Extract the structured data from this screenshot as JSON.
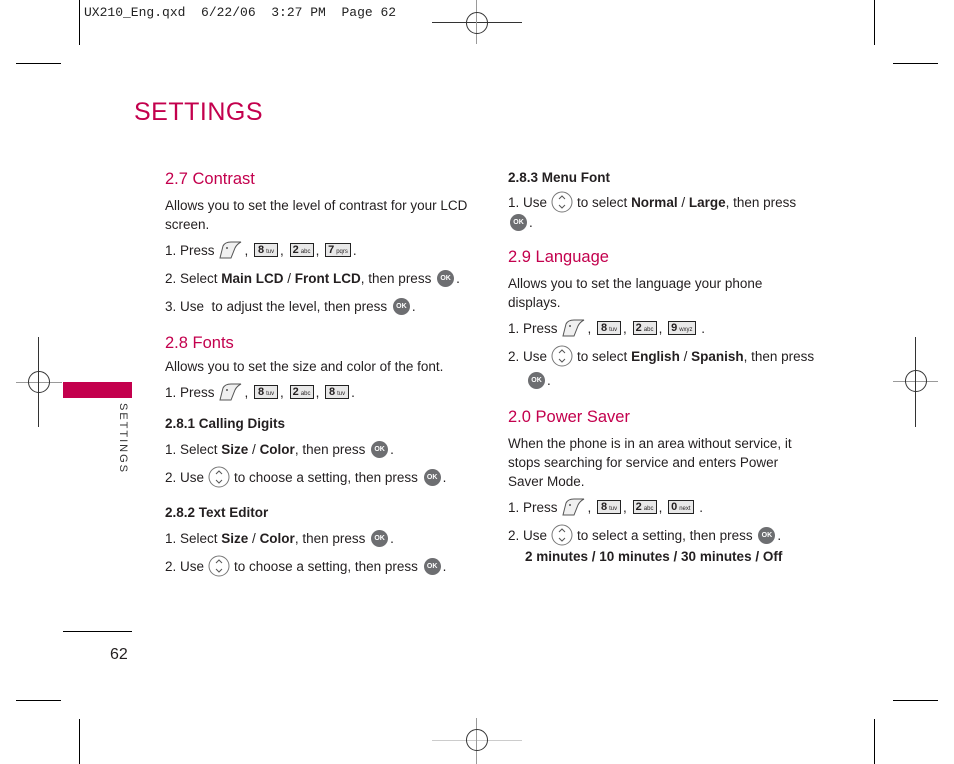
{
  "slug": {
    "filename": "UX210_Eng.qxd",
    "date": "6/22/06",
    "time": "3:27 PM",
    "page_label": "Page 62"
  },
  "page_title": "SETTINGS",
  "side_tab": {
    "label": "SETTINGS",
    "color": "#c3004d"
  },
  "page_number": "62",
  "accent_color": "#c3004d",
  "icons": {
    "menu_key": "menu-soft-key-icon",
    "nav_key": "navigation-up-down-key-icon",
    "ok_key": "ok-key-icon"
  },
  "ok_label": "OK",
  "keys": {
    "k8": {
      "main": "8",
      "sub": "tuv"
    },
    "k2": {
      "main": "2",
      "sub": "abc"
    },
    "k7": {
      "main": "7",
      "sub": "pqrs"
    },
    "k9": {
      "main": "9",
      "sub": "wxyz"
    },
    "k0": {
      "main": "0",
      "sub": "next"
    }
  },
  "sections": {
    "contrast": {
      "heading": "2.7 Contrast",
      "description": "Allows you to set the level of contrast for your LCD screen.",
      "step1_prefix": "1. Press",
      "step2_prefix": "2. Select ",
      "step2_opt1": "Main LCD",
      "step2_sep": " / ",
      "step2_opt2": "Front LCD",
      "step2_suffix": ", then press ",
      "step3_text": "3. Use  to adjust the level, then press "
    },
    "fonts": {
      "heading": "2.8 Fonts",
      "description": "Allows you to set the size and color of the font.",
      "step1_prefix": "1. Press",
      "calling_digits": {
        "heading": "2.8.1 Calling Digits",
        "step1_prefix": "1. Select ",
        "opt1": "Size",
        "sep": " / ",
        "opt2": "Color",
        "step1_suffix": ", then press ",
        "step2_prefix": "2. Use",
        "step2_suffix": "to choose a setting, then press "
      },
      "text_editor": {
        "heading": "2.8.2 Text Editor",
        "step1_prefix": "1. Select ",
        "opt1": "Size",
        "sep": " / ",
        "opt2": "Color",
        "step1_suffix": ", then press ",
        "step2_prefix": "2. Use",
        "step2_suffix": "to choose a setting, then press "
      },
      "menu_font": {
        "heading": "2.8.3 Menu Font",
        "step1_prefix": "1. Use",
        "step1_mid": "to select ",
        "opt1": "Normal",
        "sep": " / ",
        "opt2": "Large",
        "step1_suffix": ", then press "
      }
    },
    "language": {
      "heading": "2.9 Language",
      "description": "Allows you to set the language your phone displays.",
      "step1_prefix": "1. Press",
      "step2_prefix": "2. Use",
      "step2_mid": "to select ",
      "opt1": "English",
      "sep": " / ",
      "opt2": "Spanish",
      "step2_suffix": ", then press"
    },
    "power_saver": {
      "heading": "2.0 Power Saver",
      "description": "When the phone is in an area without service, it stops searching for service and enters Power Saver Mode.",
      "step1_prefix": "1. Press",
      "step2_prefix": "2. Use",
      "step2_suffix": "to select a setting, then press ",
      "options": [
        "2 minutes",
        "10 minutes",
        "30 minutes",
        "Off"
      ],
      "options_text": "2 minutes / 10 minutes / 30 minutes / Off"
    }
  }
}
